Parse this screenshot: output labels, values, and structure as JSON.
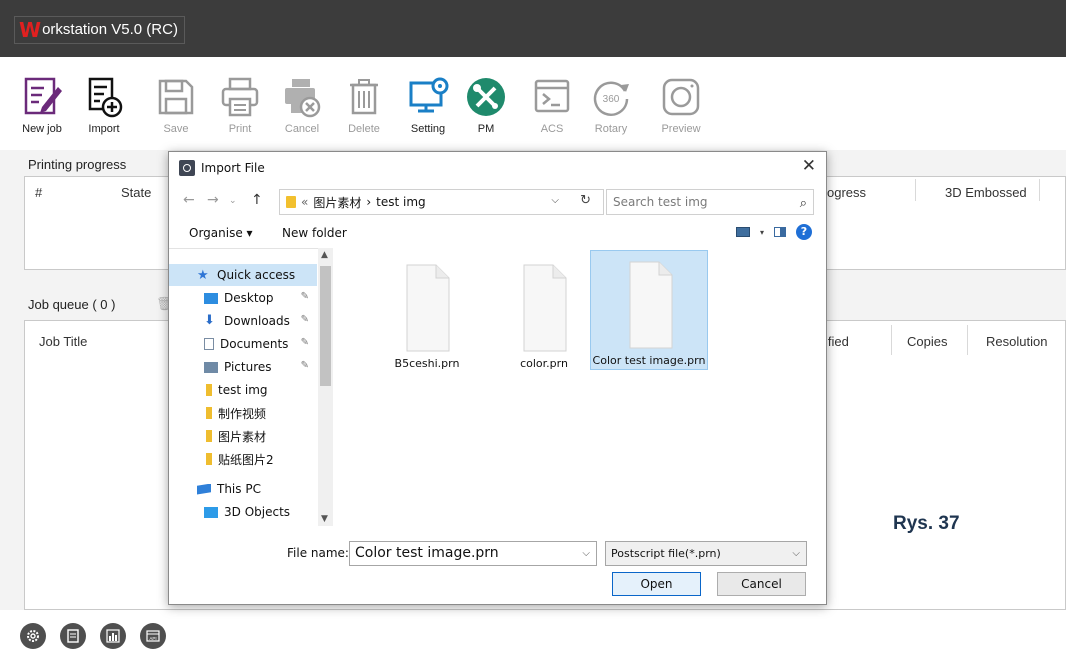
{
  "app": {
    "title_initial": "W",
    "title_rest": "orkstation V5.0 (RC)"
  },
  "toolbar": [
    {
      "label": "New job",
      "icon": "new-job-icon",
      "enabled": true
    },
    {
      "label": "Import",
      "icon": "import-icon",
      "enabled": true
    },
    {
      "label": "Save",
      "icon": "save-icon",
      "enabled": false
    },
    {
      "label": "Print",
      "icon": "print-icon",
      "enabled": false
    },
    {
      "label": "Cancel",
      "icon": "cancel-print-icon",
      "enabled": false
    },
    {
      "label": "Delete",
      "icon": "trash-icon",
      "enabled": false
    },
    {
      "label": "Setting",
      "icon": "setting-monitor-icon",
      "enabled": true
    },
    {
      "label": "PM",
      "icon": "tools-icon",
      "enabled": true
    },
    {
      "label": "ACS",
      "icon": "terminal-icon",
      "enabled": false
    },
    {
      "label": "Rotary",
      "icon": "rotary-360-icon",
      "enabled": false
    },
    {
      "label": "Preview",
      "icon": "preview-camera-icon",
      "enabled": false
    }
  ],
  "printing_progress": {
    "title": "Printing progress",
    "columns": [
      "#",
      "State",
      "ogress",
      "3D Embossed"
    ]
  },
  "job_queue": {
    "title": "Job queue ( 0 )",
    "columns": [
      "Job Title",
      "ified",
      "Copies",
      "Resolution"
    ]
  },
  "figure_label": "Rys. 37",
  "dialog": {
    "title": "Import File",
    "breadcrumb": {
      "prefix": "«",
      "parent": "图片素材",
      "sep": "›",
      "current": "test img"
    },
    "search_placeholder": "Search test img",
    "commands": {
      "organise": "Organise ▾",
      "new_folder": "New folder"
    },
    "nav_items": [
      {
        "label": "Quick access",
        "icon": "star",
        "selected": true,
        "pinned": false
      },
      {
        "label": "Desktop",
        "icon": "desktop",
        "selected": false,
        "pinned": true
      },
      {
        "label": "Downloads",
        "icon": "download",
        "selected": false,
        "pinned": true
      },
      {
        "label": "Documents",
        "icon": "doc",
        "selected": false,
        "pinned": true
      },
      {
        "label": "Pictures",
        "icon": "pic",
        "selected": false,
        "pinned": true
      },
      {
        "label": "test img",
        "icon": "folder",
        "selected": false,
        "pinned": false
      },
      {
        "label": "制作视频",
        "icon": "folder",
        "selected": false,
        "pinned": false
      },
      {
        "label": "图片素材",
        "icon": "folder",
        "selected": false,
        "pinned": false
      },
      {
        "label": "贴纸图片2",
        "icon": "folder",
        "selected": false,
        "pinned": false
      },
      {
        "label": "This PC",
        "icon": "pc",
        "selected": false,
        "pinned": false
      },
      {
        "label": "3D Objects",
        "icon": "3d",
        "selected": false,
        "pinned": false
      }
    ],
    "files": [
      {
        "name": "B5ceshi.prn",
        "selected": false
      },
      {
        "name": "color.prn",
        "selected": false
      },
      {
        "name": "Color test image.prn",
        "selected": true
      }
    ],
    "file_name_label": "File name:",
    "file_name_value": "Color test image.prn",
    "file_type": "Postscript file(*.prn)",
    "open_label": "Open",
    "cancel_label": "Cancel"
  }
}
